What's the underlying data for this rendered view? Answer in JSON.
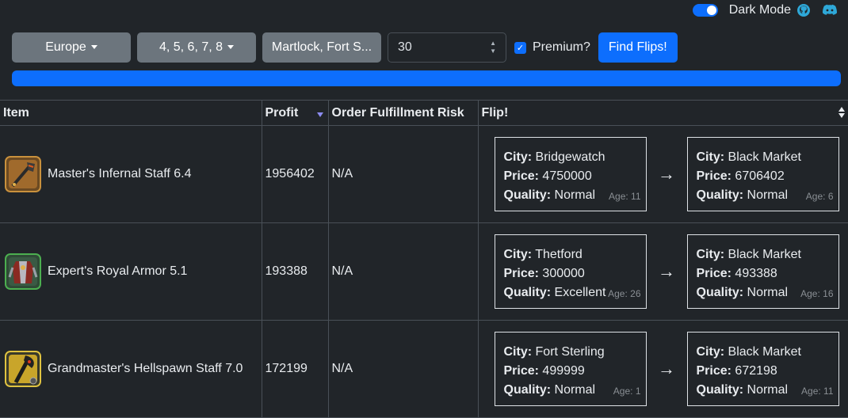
{
  "topbar": {
    "dark_mode_label": "Dark Mode",
    "github_icon": "github-icon",
    "discord_icon": "discord-icon"
  },
  "controls": {
    "region": "Europe",
    "tiers": "4, 5, 6, 7, 8",
    "cities": "Martlock, Fort S...",
    "hours_value": "30",
    "premium_label": "Premium?",
    "find_label": "Find Flips!"
  },
  "progress": {
    "percent": 100
  },
  "table": {
    "headers": {
      "item": "Item",
      "profit": "Profit",
      "risk": "Order Fulfillment Risk",
      "flip": "Flip!"
    },
    "labels": {
      "city": "City:",
      "price": "Price:",
      "quality": "Quality:",
      "arrow": "→"
    },
    "rows": [
      {
        "item": "Master's Infernal Staff 6.4",
        "icon": "staff-icon",
        "profit": "1956402",
        "risk": "N/A",
        "from": {
          "city": "Bridgewatch",
          "price": "4750000",
          "quality": "Normal",
          "age": "Age: 11"
        },
        "to": {
          "city": "Black Market",
          "price": "6706402",
          "quality": "Normal",
          "age": "Age: 6"
        }
      },
      {
        "item": "Expert's Royal Armor 5.1",
        "icon": "armor-icon",
        "profit": "193388",
        "risk": "N/A",
        "from": {
          "city": "Thetford",
          "price": "300000",
          "quality": "Excellent",
          "age": "Age: 26"
        },
        "to": {
          "city": "Black Market",
          "price": "493388",
          "quality": "Normal",
          "age": "Age: 16"
        }
      },
      {
        "item": "Grandmaster's Hellspawn Staff 7.0",
        "icon": "hellspawn-staff-icon",
        "profit": "172199",
        "risk": "N/A",
        "from": {
          "city": "Fort Sterling",
          "price": "499999",
          "quality": "Normal",
          "age": "Age: 1"
        },
        "to": {
          "city": "Black Market",
          "price": "672198",
          "quality": "Normal",
          "age": "Age: 11"
        }
      }
    ]
  }
}
